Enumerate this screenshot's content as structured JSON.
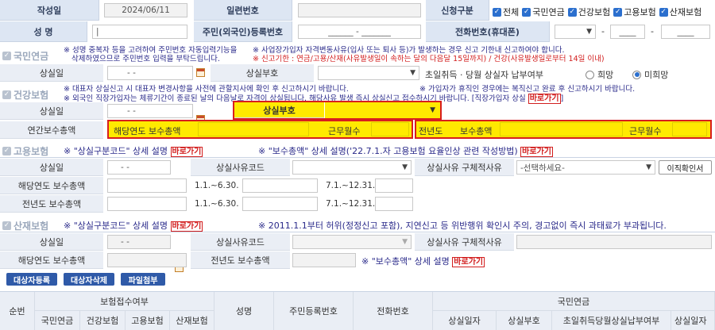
{
  "top": {
    "write_date_label": "작성일",
    "write_date_value": "2024/06/11",
    "serial_label": "일련번호",
    "request_type_label": "신청구분",
    "request_types": [
      "전체",
      "국민연금",
      "건강보험",
      "고용보험",
      "산재보험"
    ],
    "name_label": "성 명",
    "rrn_label": "주민(외국인)등록번호",
    "rrn_value": "______ - _______",
    "phone_label": "전화번호(휴대폰)",
    "phone_dash1": "-",
    "phone_mid": "____",
    "phone_dash2": "-",
    "phone_last": "____"
  },
  "pension": {
    "title": "국민연금",
    "note1a": "※ 성명 중복자 등을 고려하여 주민번호 자동입력기능을",
    "note1b": "삭제하였으므로 주민번호 입력을 부탁드립니다.",
    "note2a": "※ 사업장가입자 자격변동사유(입사 또는 퇴사 등)가 발생하는 경우 신고 기한내 신고하여야 합니다.",
    "note2b": "※ 신고기한 : 연금/고용/산재(사유발생일이 속하는 달의 다음달 15일까지) / 건강(사유발생일로부터 14일 이내)",
    "loss_date_label": "상실일",
    "loss_date_value": "- -",
    "loss_code_label": "상실부호",
    "first_day_label": "초일취득 · 당월 상실자 납부여부",
    "hope": "희망",
    "no_hope": "미희망"
  },
  "health": {
    "title": "건강보험",
    "note1": "※ 대표자 상실신고 시 대표자 변경사항을 사전에 관할지사에 확인 후 신고하시기 바랍니다.",
    "note2": "※ 가입자가 휴직인 경우에는 복직신고 완료 후 신고하시기 바랍니다.",
    "note3": "※ 외국인 직장가입자는 체류기간이 종료된 날의 다음날로 자격이 상실됩니다. 해당사유 발생 즉시 상실신고 접수하시기 바랍니다. [직장가입자 상실",
    "go_link": "바로가기",
    "note3_end": "]",
    "loss_date_label": "상실일",
    "loss_date_value": "- -",
    "loss_code_label": "상실부호",
    "annual_pay_label": "연간보수총액",
    "this_year_pay_label": "해당연도 보수총액",
    "work_months_label": "근무월수",
    "prev_year_label": "전년도",
    "prev_pay_label": "보수총액",
    "prev_months_label": "근무월수"
  },
  "employment": {
    "title": "고용보험",
    "note1": "※ \"상실구분코드\" 상세 설명",
    "go_link1": "바로가기",
    "note2": "※ \"보수총액\" 상세 설명('22.7.1.자 고용보험 요율인상 관련 작성방법)",
    "go_link2": "바로가기",
    "loss_date_label": "상실일",
    "loss_date_value": "- -",
    "reason_code_label": "상실사유코드",
    "reason_detail_label": "상실사유 구체적사유",
    "reason_select": "-선택하세요-",
    "confirm_btn": "이직확인서",
    "this_year_pay_label": "해당연도 보수총액",
    "prev_year_pay_label": "전년도 보수총액",
    "period1": "1.1.~6.30.",
    "period2": "7.1.~12.31."
  },
  "industrial": {
    "title": "산재보험",
    "note1": "※ \"상실구분코드\" 상세 설명",
    "go_link1": "바로가기",
    "note2": "※ 2011.1.1부터 허위(정정신고 포함), 지연신고 등 위반행위 확인시 주의, 경고없이 즉시 과태료가 부과됩니다.",
    "loss_date_label": "상실일",
    "loss_date_value": "- -",
    "reason_code_label": "상실사유코드",
    "reason_detail_label": "상실사유 구체적사유",
    "this_year_pay_label": "해당연도 보수총액",
    "prev_year_pay_label": "전년도 보수총액",
    "note3": "※ \"보수총액\" 상세 설명",
    "go_link3": "바로가기"
  },
  "buttons": {
    "register": "대상자등록",
    "delete": "대상자삭제",
    "attach": "파일첨부"
  },
  "table": {
    "seq": "순번",
    "receipt": "보험접수여부",
    "receipt_cols": [
      "국민연금",
      "건강보험",
      "고용보험",
      "산재보험"
    ],
    "name": "성명",
    "rrn": "주민등록번호",
    "phone": "전화번호",
    "pension_group": "국민연금",
    "pension_cols": [
      "상실일자",
      "상실부호",
      "초일취득당월상실납부여부",
      "상실일자"
    ]
  }
}
